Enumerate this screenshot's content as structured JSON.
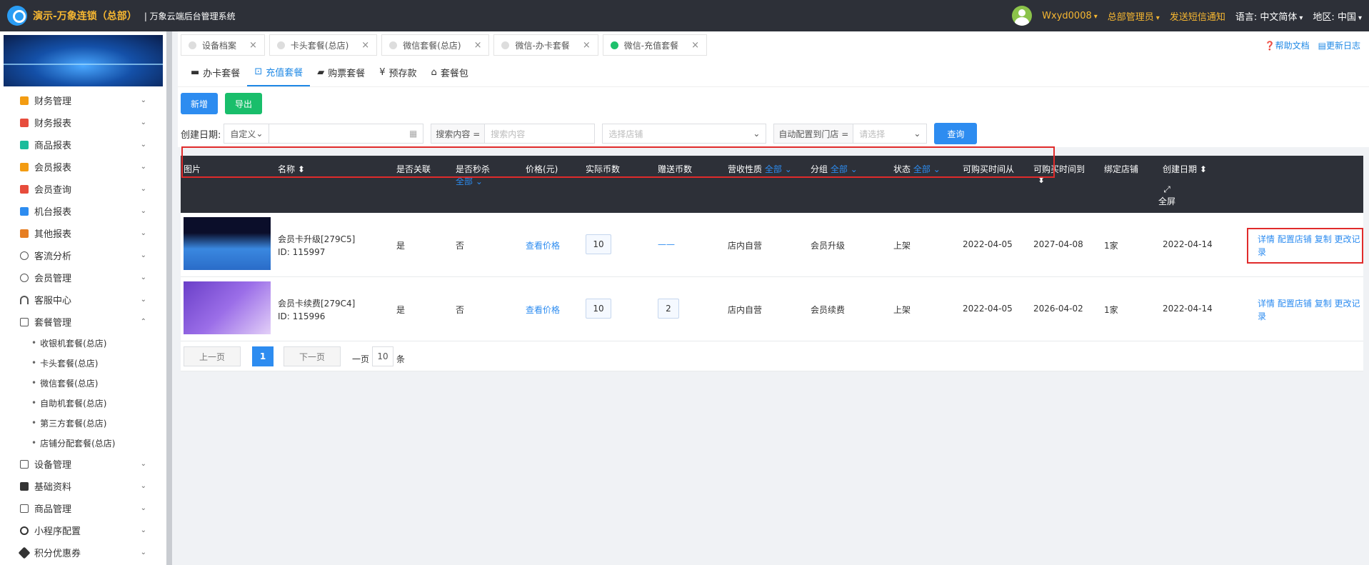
{
  "app": {
    "brand": "演示-万象连锁（总部）",
    "subtitle": "| 万象云端后台管理系统"
  },
  "topbar": {
    "user": "Wxyd0008",
    "role": "总部管理员",
    "sms": "发送短信通知",
    "lang_label": "语言:",
    "lang_value": "中文简体",
    "region_label": "地区:",
    "region_value": "中国"
  },
  "sidebar": {
    "items": [
      {
        "label": "财务管理",
        "color": "#f39c12"
      },
      {
        "label": "财务报表",
        "color": "#e74c3c"
      },
      {
        "label": "商品报表",
        "color": "#1abc9c"
      },
      {
        "label": "会员报表",
        "color": "#f39c12"
      },
      {
        "label": "会员查询",
        "color": "#e74c3c"
      },
      {
        "label": "机台报表",
        "color": "#2d8cf0"
      },
      {
        "label": "其他报表",
        "color": "#e67e22"
      },
      {
        "label": "客流分析",
        "color": "#555555"
      },
      {
        "label": "会员管理",
        "color": "#555555"
      },
      {
        "label": "客服中心",
        "color": "#555555"
      },
      {
        "label": "套餐管理",
        "color": "#555555"
      }
    ],
    "subitems": [
      "收银机套餐(总店)",
      "卡头套餐(总店)",
      "微信套餐(总店)",
      "自助机套餐(总店)",
      "第三方套餐(总店)",
      "店铺分配套餐(总店)"
    ],
    "items_after": [
      {
        "label": "设备管理"
      },
      {
        "label": "基础资料"
      },
      {
        "label": "商品管理"
      },
      {
        "label": "小程序配置"
      },
      {
        "label": "积分优惠券"
      }
    ]
  },
  "tabs": [
    {
      "label": "设备档案",
      "active": false
    },
    {
      "label": "卡头套餐(总店)",
      "active": false
    },
    {
      "label": "微信套餐(总店)",
      "active": false
    },
    {
      "label": "微信-办卡套餐",
      "active": false
    },
    {
      "label": "微信-充值套餐",
      "active": true
    }
  ],
  "help": {
    "docs": "帮助文档",
    "changelog": "更新日志"
  },
  "subtabs": [
    {
      "icon": "▬",
      "label": "办卡套餐"
    },
    {
      "icon": "⊡",
      "label": "充值套餐"
    },
    {
      "icon": "▰",
      "label": "购票套餐"
    },
    {
      "icon": "¥",
      "label": "预存款"
    },
    {
      "icon": "⌂",
      "label": "套餐包"
    }
  ],
  "toolbar": {
    "add": "新增",
    "export": "导出"
  },
  "filters": {
    "date_label": "创建日期:",
    "date_mode": "自定义",
    "search_prefix": "搜索内容 =",
    "search_placeholder": "搜索内容",
    "store_placeholder": "选择店铺",
    "auto_prefix": "自动配置到门店 =",
    "auto_placeholder": "请选择",
    "query": "查询"
  },
  "table": {
    "headers": {
      "image": "图片",
      "name": "名称",
      "linked": "是否关联",
      "flash": "是否秒杀",
      "flash_filter": "全部",
      "price": "价格(元)",
      "coins": "实际币数",
      "bonus": "赠送币数",
      "revenue": "营收性质",
      "revenue_filter": "全部",
      "group": "分组",
      "group_filter": "全部",
      "status": "状态",
      "status_filter": "全部",
      "from": "可购买时间从",
      "to": "可购买时间到",
      "store": "绑定店铺",
      "created": "创建日期",
      "fullscreen": "全屏"
    },
    "rows": [
      {
        "name": "会员卡升级[279C5]",
        "id": "ID: 115997",
        "linked": "是",
        "flash": "否",
        "price": "查看价格",
        "coins": "10",
        "bonus": "——",
        "revenue": "店内自营",
        "group": "会员升级",
        "status": "上架",
        "from": "2022-04-05",
        "to": "2027-04-08",
        "store": "1家",
        "created": "2022-04-14",
        "actions": [
          "详情",
          "配置店铺",
          "复制",
          "更改记录"
        ]
      },
      {
        "name": "会员卡续费[279C4]",
        "id": "ID: 115996",
        "linked": "是",
        "flash": "否",
        "price": "查看价格",
        "coins": "10",
        "bonus": "2",
        "revenue": "店内自营",
        "group": "会员续费",
        "status": "上架",
        "from": "2022-04-05",
        "to": "2026-04-02",
        "store": "1家",
        "created": "2022-04-14",
        "actions": [
          "详情",
          "配置店铺",
          "复制",
          "更改记录"
        ]
      }
    ]
  },
  "pager": {
    "prev": "上一页",
    "current": "1",
    "next": "下一页",
    "per_page_label": "一页",
    "per_page": "10",
    "unit": "条"
  }
}
